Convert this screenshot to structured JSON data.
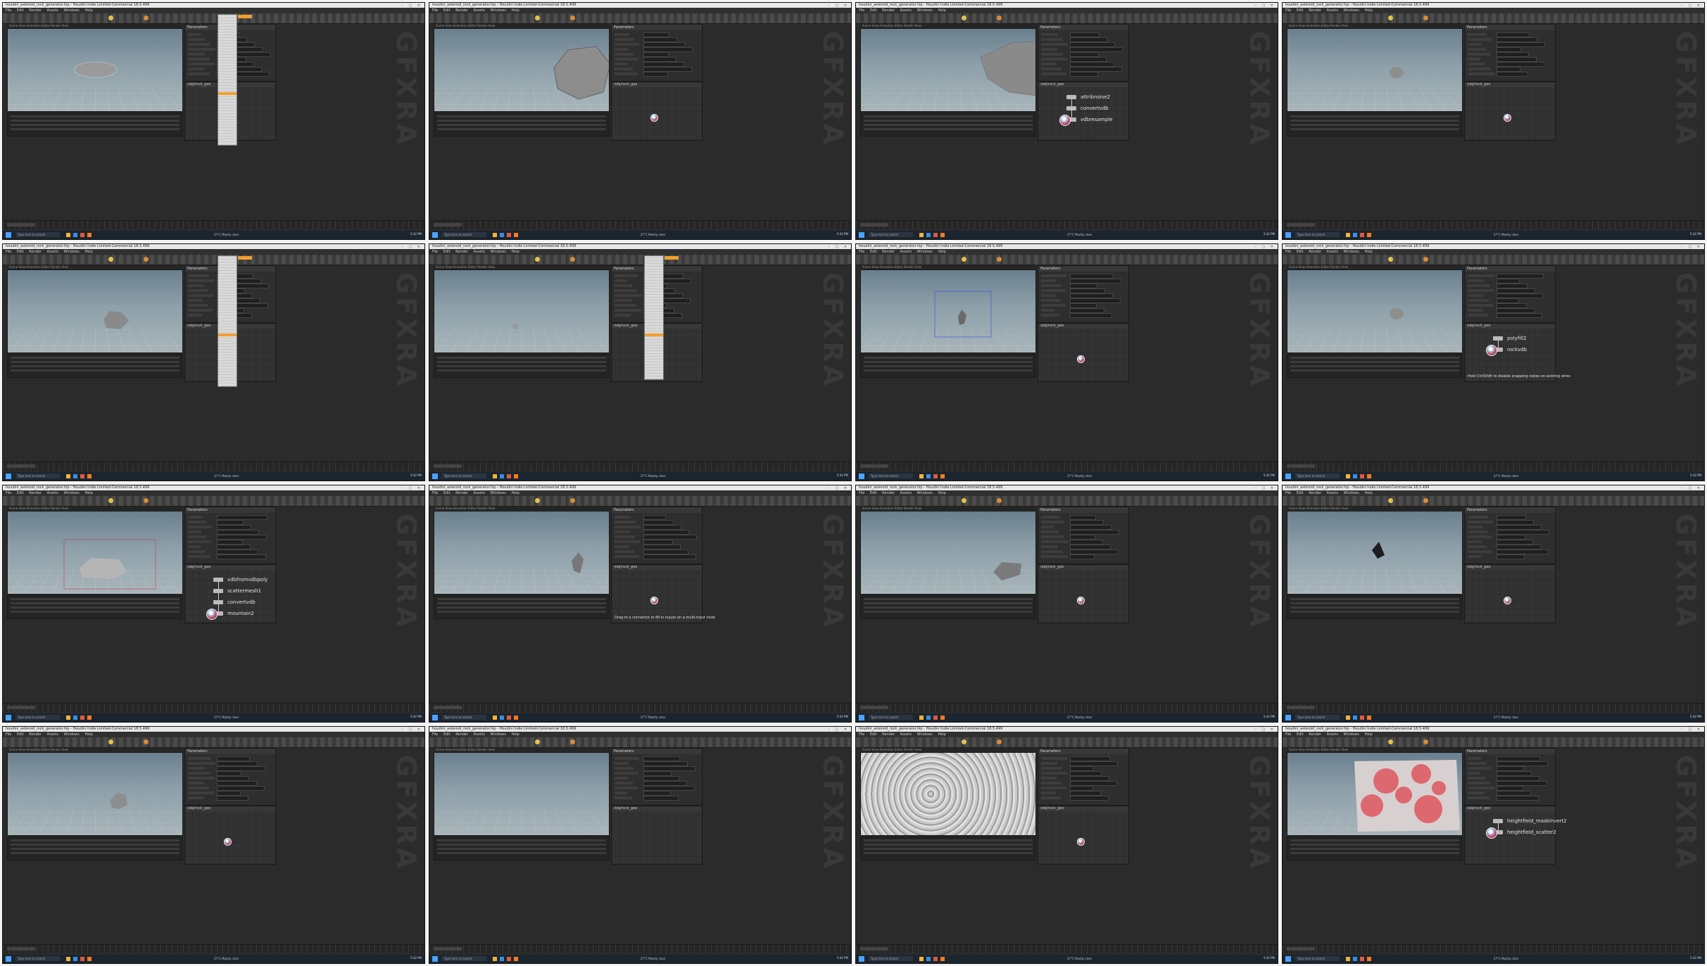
{
  "app": {
    "window_title": "houdini_asteroid_rock_generator.hip - Houdini Indie Limited-Commercial 18.5.499",
    "menu": [
      "File",
      "Edit",
      "Render",
      "Assets",
      "Windows",
      "Help"
    ],
    "watermark": "GFXRA",
    "taskbar_search": "Type here to search",
    "taskbar_status": "27°C  Mostly clear",
    "taskbar_clock": "5:42 PM",
    "viewport_bar": "Scene View  Animation Editor  Render View",
    "network_bar": "/obj/rock_geo",
    "parm_bar": "Parameters"
  },
  "accent_colors": {
    "orange": "#f0a030",
    "blue_box": "#4b5fd6",
    "red_box": "#c04040",
    "red_attr": "#e0303a"
  },
  "shots": [
    {
      "id": 1,
      "viewport": "ellipsoid-rock",
      "dropdown": true,
      "nodes": []
    },
    {
      "id": 2,
      "viewport": "large-rock",
      "dropdown": false,
      "nodes": []
    },
    {
      "id": 3,
      "viewport": "closeup-rock",
      "dropdown": false,
      "nodes": [
        "attribnoise2",
        "convertvdb",
        "vdbresample"
      ]
    },
    {
      "id": 4,
      "viewport": "small-rock",
      "dropdown": false,
      "nodes": []
    },
    {
      "id": 5,
      "viewport": "rock",
      "dropdown": true,
      "nodes": []
    },
    {
      "id": 6,
      "viewport": "tiny-rock",
      "dropdown": true,
      "nodes": []
    },
    {
      "id": 7,
      "viewport": "boxed-rock",
      "dropdown": false,
      "nodes": []
    },
    {
      "id": 8,
      "viewport": "small-rock",
      "dropdown": false,
      "nodes": [
        "polyfill2",
        "rockvdb"
      ],
      "message": "Hold Ctrl/Shift to disable snapping nodes on existing wires"
    },
    {
      "id": 9,
      "viewport": "red-boxed-rock",
      "dropdown": false,
      "nodes": [
        "vdbfromvdbpoly",
        "scattermesh1",
        "convertvdb",
        "mountain2"
      ]
    },
    {
      "id": 10,
      "viewport": "shard-rock",
      "dropdown": false,
      "nodes": [],
      "message": "Drag to a connector to fill in inputs on a multi-input node"
    },
    {
      "id": 11,
      "viewport": "flat-rock",
      "dropdown": false,
      "nodes": []
    },
    {
      "id": 12,
      "viewport": "dark-rock",
      "dropdown": false,
      "nodes": []
    },
    {
      "id": 13,
      "viewport": "lumpy-rock",
      "dropdown": false,
      "nodes": []
    },
    {
      "id": 14,
      "viewport": "empty",
      "dropdown": false,
      "nodes": []
    },
    {
      "id": 15,
      "viewport": "terrain-grey",
      "dropdown": false,
      "nodes": []
    },
    {
      "id": 16,
      "viewport": "terrain-red",
      "dropdown": false,
      "nodes": [
        "heightfield_maskinvert2",
        "heightfield_scatter2"
      ]
    }
  ]
}
